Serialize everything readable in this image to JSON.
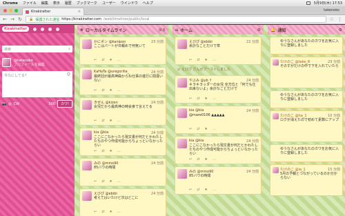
{
  "os_menubar": {
    "app": "Chrome",
    "items": [
      "ファイル",
      "編集",
      "表示",
      "履歴",
      "ブックマーク",
      "ユーザー",
      "ウインドウ",
      "ヘルプ"
    ],
    "clock": "5月9日(木) 17:53"
  },
  "browser": {
    "tab_title": "Kirakiratter",
    "profile": "takenoko",
    "secure_label": "保護された通信",
    "url_domain": "https://kirakiratter.com",
    "url_path": "/web/timelines/public/local"
  },
  "compose": {
    "logo": "Kirakiratter",
    "search_placeholder": "検索",
    "profile_name": "@takenoko",
    "profile_edit": "プロフィールを編集",
    "textarea_placeholder": "今なにしてる？",
    "cw_label": "CW",
    "char_count": "500",
    "submit_label": "カワ!"
  },
  "columns": {
    "local": {
      "title": "ローカルタイムライン",
      "back_label": "戻る",
      "statuses": [
        {
          "name": "かにポン @kanipon",
          "time": "23 分前",
          "text": "ここはパートが日報めで何気いて"
        },
        {
          "name": "KaHaTa @uregorilla_",
          "time": "24 分前",
          "text": "最終回が最高神曲からね仕事の進行に間違いない"
        },
        {
          "name": "きぜん @kizen",
          "time": "24 分前",
          "text": "女児だから最高神の時会食で言えてる"
        },
        {
          "name": "kia @kia",
          "time": "24 分前",
          "text": "ここにこなかったら現文書が何だとかわたしたちのやつ作成可能からちょっといなかったらい"
        },
        {
          "name": "みの @mino90",
          "time": "24 分前",
          "text": "85バウの時間"
        },
        {
          "name": "えびぴ @ebibi",
          "time": "24 分前",
          "text": "考えてはいたけど次はどこに"
        }
      ]
    },
    "home": {
      "title": "ホーム",
      "statuses": [
        {
          "name": "えびぴ @ebibi",
          "time": "22 分前",
          "text": "余計なことだけで草"
        },
        {
          "name": "やぶみ @yb_f",
          "time": "24 分前",
          "text": "キラキラッターの女児 全方位と「何でも仕出来ないよ」余計なことだけで"
        },
        {
          "name": "kia @kia",
          "time": "24 分前",
          "text": "@mare0106 ▲▲▲▲▲"
        },
        {
          "name": "kia @kia",
          "time": "24 分前",
          "text": "ここにこなかったら現文書が何だとかわたしたちのやつ作成可能からちょっといなかったらい"
        },
        {
          "name": "みの @mino90",
          "time": "24 分前",
          "text": "85バウの時間"
        },
        {
          "name": "えびぴ @ebibi",
          "time": "24 分前",
          "text": "考えてはいたけど次はどこに"
        }
      ],
      "boost_text": "えびぴ さんがブーストしました"
    },
    "notifications": {
      "title": "通知",
      "statuses": [
        {
          "name": "ゆうなさんがあなたのカワをお気に入りに登録しました",
          "time": "",
          "text": ""
        },
        {
          "name": "たけのこ @take_8",
          "time": "23 分前",
          "text": "そのすがだけの中で下を入れていたら"
        },
        {
          "name": "ゆうなさんがあなたのカワをお気に入りに登録しました",
          "time": "",
          "text": ""
        },
        {
          "name": "たけのこ @ha_1",
          "time": "10 分前",
          "text": "ログが消えたので初めて素数にアップ"
        },
        {
          "name": "ゆうなさんがあなたのカワをお気に入りに登録しました",
          "time": "",
          "text": ""
        },
        {
          "name": "たけのこ @ia_1",
          "time": "15 分前",
          "text": "5月の予報とつながっているのか分からない"
        }
      ]
    }
  }
}
